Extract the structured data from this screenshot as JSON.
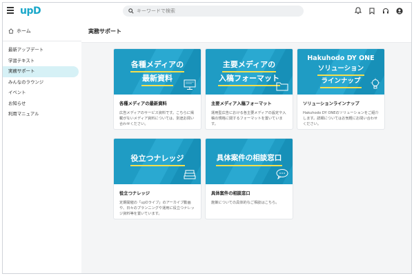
{
  "header": {
    "logo_text": "upD",
    "search_placeholder": "キーワードで検索",
    "icons": [
      "bell-icon",
      "bookmark-icon",
      "headset-icon",
      "user-icon"
    ]
  },
  "sidebar": {
    "home_label": "ホーム",
    "items": [
      {
        "label": "最新アップデート",
        "active": false
      },
      {
        "label": "学習テキスト",
        "active": false
      },
      {
        "label": "実務サポート",
        "active": true
      },
      {
        "label": "みんなのラウンジ",
        "active": false
      },
      {
        "label": "イベント",
        "active": false
      },
      {
        "label": "お知らせ",
        "active": false
      },
      {
        "label": "利用マニュアル",
        "active": false
      }
    ]
  },
  "main": {
    "title": "実務サポート",
    "cards": [
      {
        "image_lines": [
          "各種メディアの",
          "最新資料"
        ],
        "heading": "各種メディアの最新資料",
        "description": "広告メディアのサービス資料です。こちらに掲載がないメディア資料については、別途お問い合わせください。",
        "icon": "monitor-icon"
      },
      {
        "image_lines": [
          "主要メディアの",
          "入稿フォーマット"
        ],
        "heading": "主要メディア入稿フォーマット",
        "description": "運用型広告における各主要メディアの設定や入稿の規格に関するフォーマットを置いています。",
        "icon": "folder-icon"
      },
      {
        "image_lines": [
          "Hakuhodo DY ONE",
          "ソリューション",
          "ラインナップ"
        ],
        "heading": "ソリューションラインナップ",
        "description": "Hakuhodo DY ONEのソリューションをご紹介します。詳細についてはお気軽にお問い合わせください。",
        "icon": "lightbulb-icon"
      },
      {
        "image_lines": [
          "役立つナレッジ"
        ],
        "heading": "役立つナレッジ",
        "description": "定期開催の「upDライブ」のアーカイブ動画や、日々のプランニングや運用に役立つナレッジ資料等を置いています。",
        "icon": "books-icon"
      },
      {
        "image_lines": [
          "具体案件の相談窓口"
        ],
        "heading": "具体案件の相談窓口",
        "description": "施策についての具体的なご相談はこちら。",
        "icon": "chat-bubble-icon"
      }
    ]
  },
  "colors": {
    "accent": "#19a7c9",
    "card_blue": "#1f9cc4",
    "card_blue_dark": "#1588b0",
    "underline": "#f4e04d",
    "sidebar_active": "#d6f1f6"
  }
}
